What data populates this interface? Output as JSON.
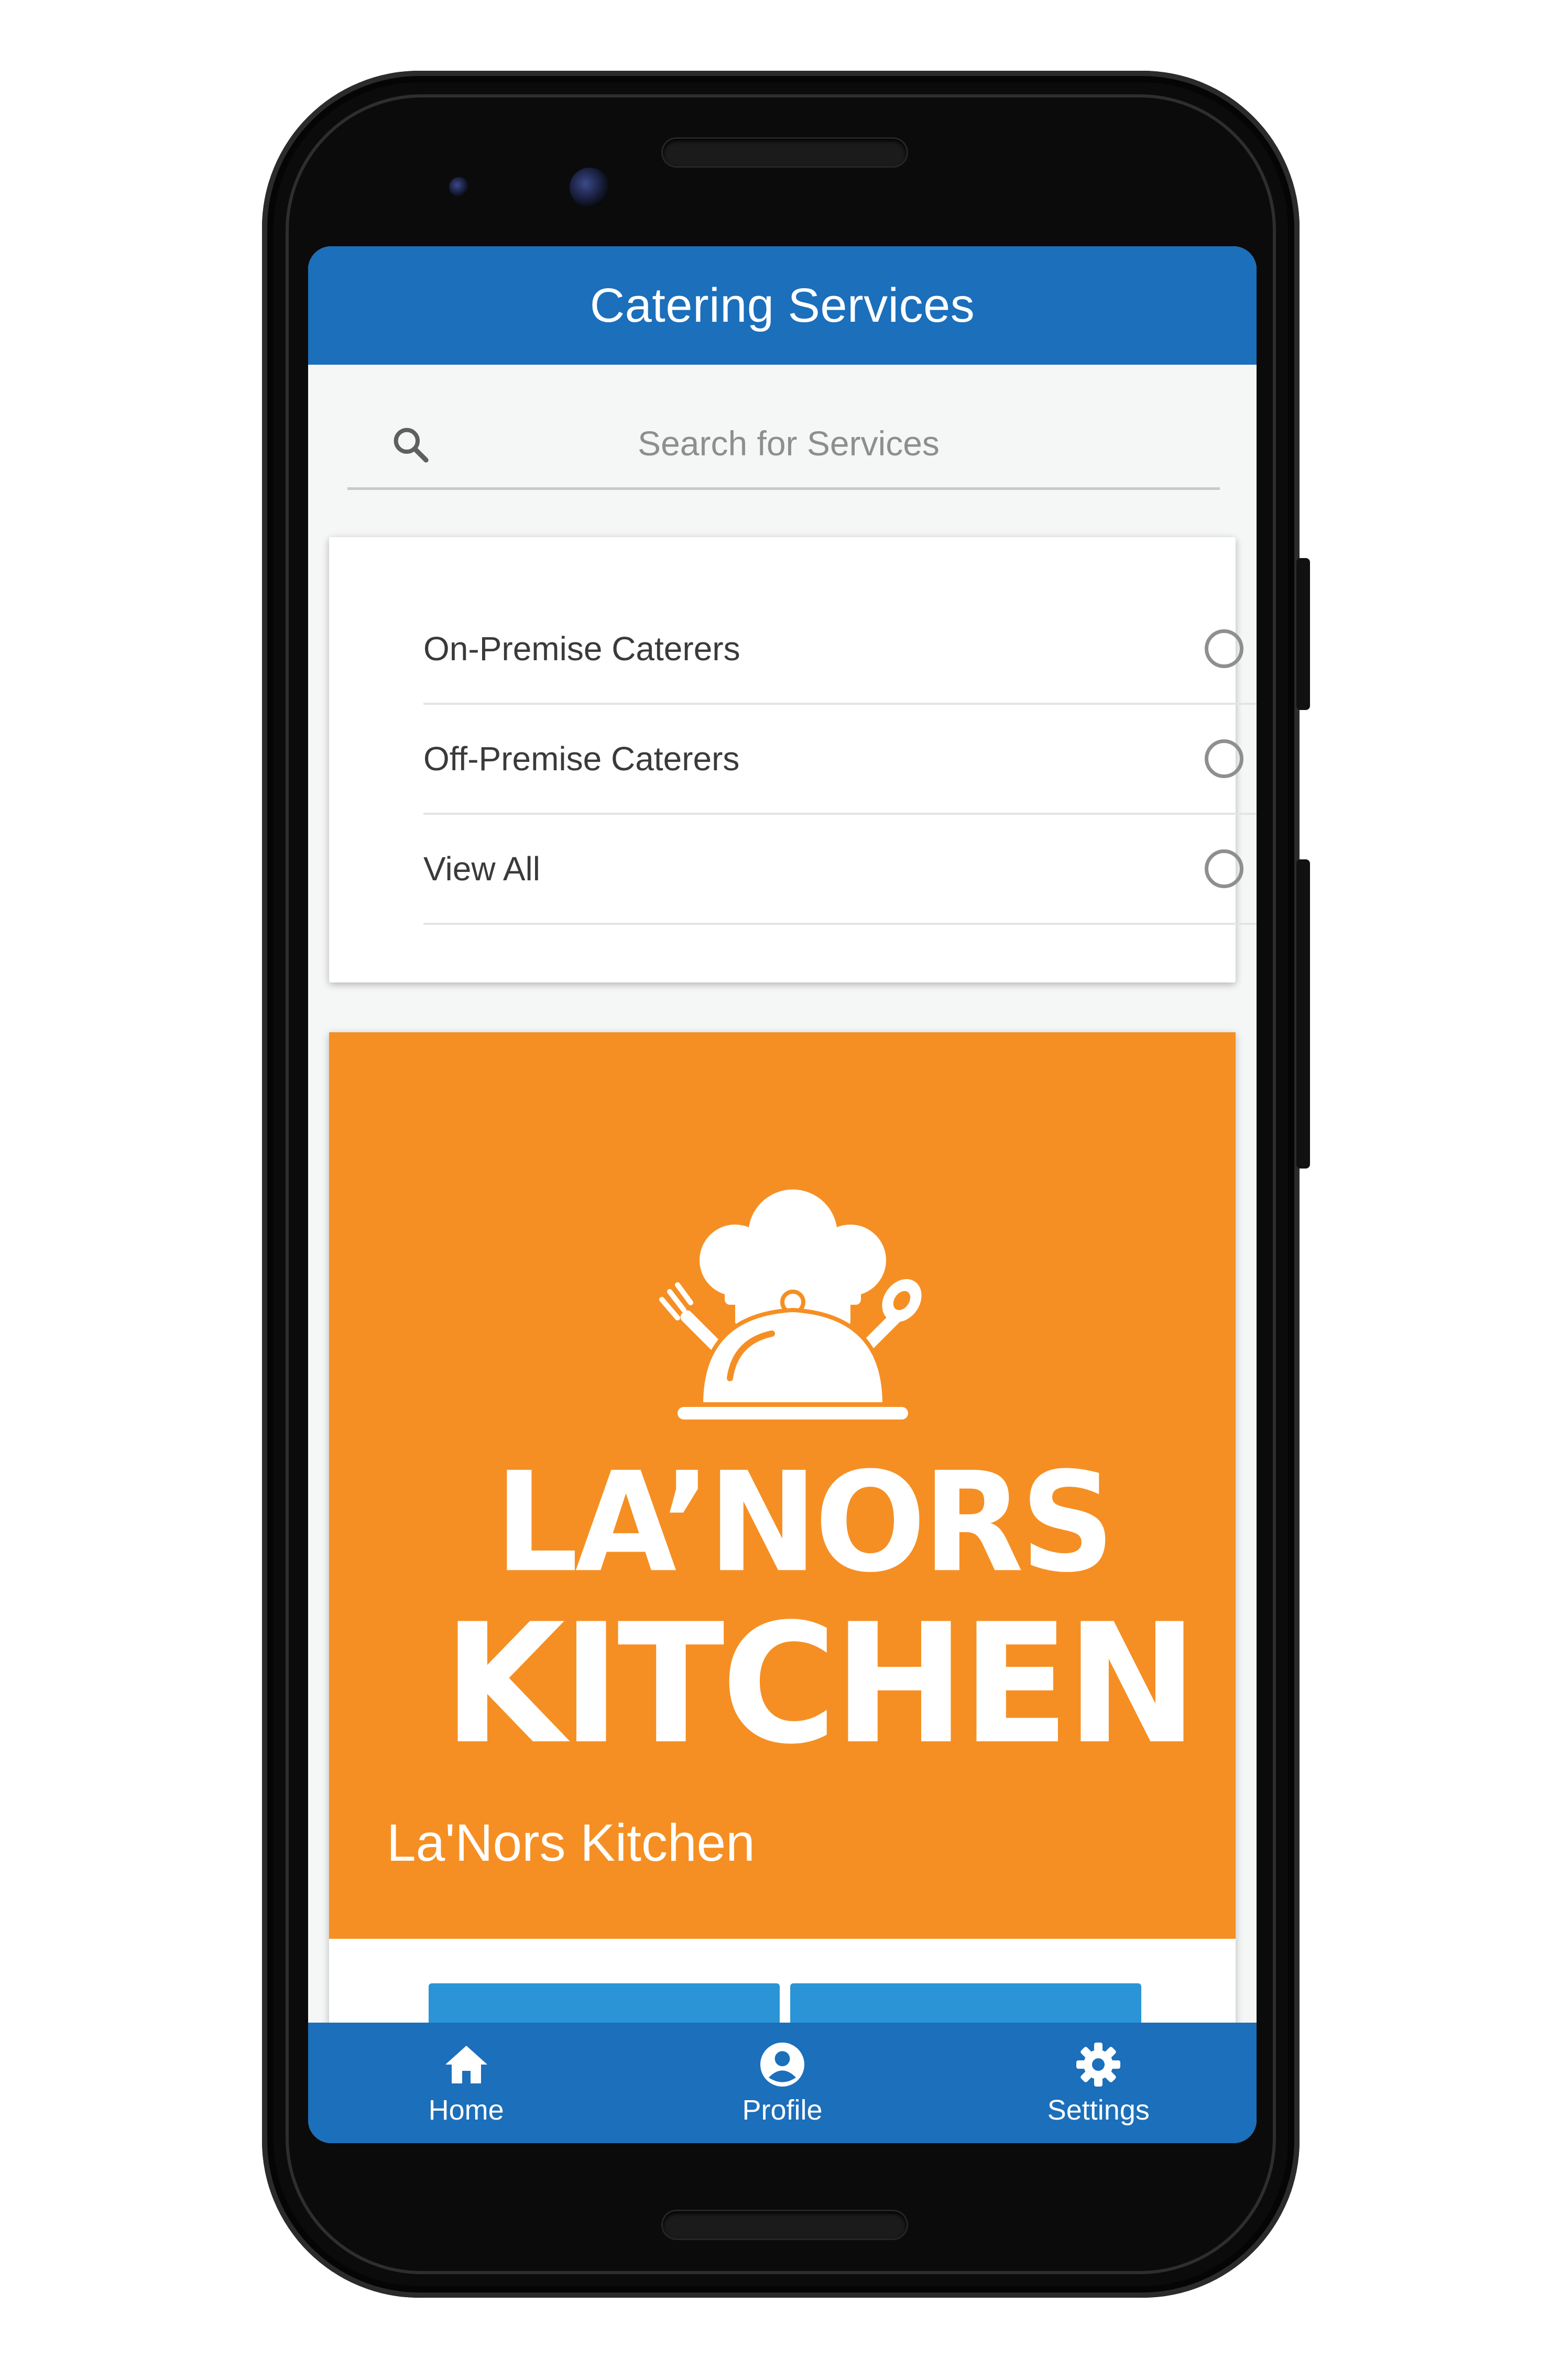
{
  "app": {
    "title": "Catering Services"
  },
  "search": {
    "placeholder": "Search for Services",
    "icon": "search-icon"
  },
  "filters": {
    "options": [
      {
        "label": "On-Premise Caterers",
        "selected": false
      },
      {
        "label": "Off-Premise Caterers",
        "selected": false
      },
      {
        "label": "View All",
        "selected": false
      }
    ]
  },
  "caterer": {
    "logo_line1": "LA’NORS",
    "logo_line2": "KITCHEN",
    "name": "La'Nors Kitchen",
    "banner_color": "#f58f23"
  },
  "nav": {
    "items": [
      {
        "label": "Home",
        "icon": "home-icon"
      },
      {
        "label": "Profile",
        "icon": "profile-icon"
      },
      {
        "label": "Settings",
        "icon": "gear-icon"
      }
    ]
  },
  "colors": {
    "primary": "#1b6fbb",
    "accent_button": "#2a94d6",
    "banner": "#f58f23"
  }
}
